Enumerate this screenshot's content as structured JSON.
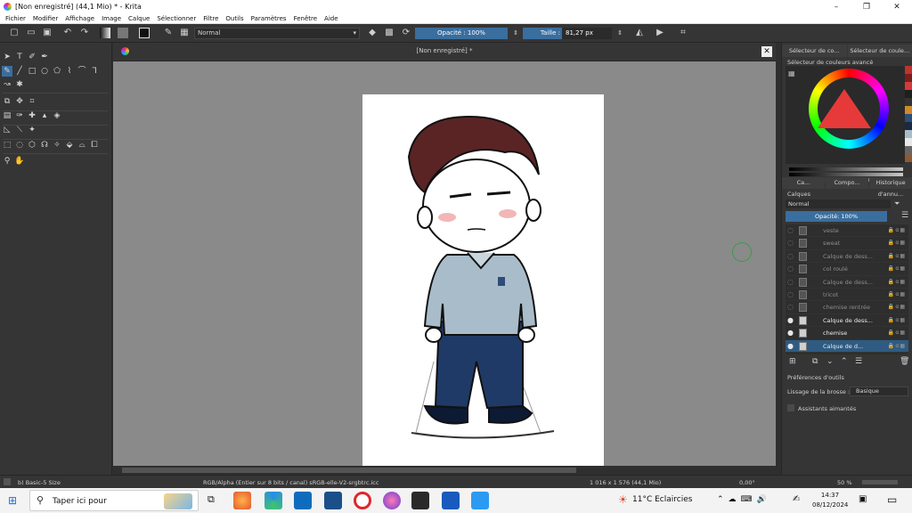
{
  "window": {
    "title": "[Non enregistré]  (44,1 Mio)  * - Krita",
    "minimize": "–",
    "maximize": "❐",
    "close": "✕"
  },
  "menu": [
    "Fichier",
    "Modifier",
    "Affichage",
    "Image",
    "Calque",
    "Sélectionner",
    "Filtre",
    "Outils",
    "Paramètres",
    "Fenêtre",
    "Aide"
  ],
  "toolbar": {
    "blend_mode": "Normal",
    "opacity": "Opacité : 100%",
    "size_label": "Taille :",
    "size_value": "81,27 px"
  },
  "document": {
    "tab_title": "[Non enregistré]  *"
  },
  "dock": {
    "top_tabs": [
      "Sélecteur de co...",
      "Sélecteur de coule..."
    ],
    "color_panel_title": "Sélecteur de couleurs avancé",
    "sub_tabs": [
      "Ca...",
      "Compo...",
      "Historique d'annu..."
    ],
    "layers_title": "Calques",
    "layers_mode": "Normal",
    "layers_opacity": "Opacité:  100%",
    "layers": [
      {
        "name": "veste",
        "visible": false,
        "selected": false
      },
      {
        "name": "sweat",
        "visible": false,
        "selected": false
      },
      {
        "name": "Calque de dess...",
        "visible": false,
        "selected": false
      },
      {
        "name": "col roulé",
        "visible": false,
        "selected": false
      },
      {
        "name": "Calque de dess...",
        "visible": false,
        "selected": false
      },
      {
        "name": "tricot",
        "visible": false,
        "selected": false
      },
      {
        "name": "chemise rentrée",
        "visible": false,
        "selected": false
      },
      {
        "name": "Calque de dess...",
        "visible": true,
        "selected": false
      },
      {
        "name": "chemise",
        "visible": true,
        "selected": false
      },
      {
        "name": "Calque de d...",
        "visible": true,
        "selected": true
      }
    ],
    "tool_options_title": "Préférences d'outils",
    "smoothing_label": "Lissage de la brosse :",
    "smoothing_value": "Basique",
    "magnet_label": "Assistants aimantés"
  },
  "status": {
    "brush": "b) Basic-5 Size",
    "color_profile": "RGB/Alpha (Entier sur 8 bits / canal)  sRGB-elle-V2-srgbtrc.icc",
    "dimensions": "1 016 x 1 576 (44,1 Mio)",
    "angle": "0,00°",
    "zoom": "50 %"
  },
  "taskbar": {
    "search_placeholder": "Taper ici pour",
    "weather": "11°C  Eclaircies",
    "time": "14:37",
    "date": "08/12/2024"
  },
  "colors": {
    "accent": "#3a6e9e",
    "panel": "#353535",
    "canvas_bg": "#8a8a8a"
  }
}
